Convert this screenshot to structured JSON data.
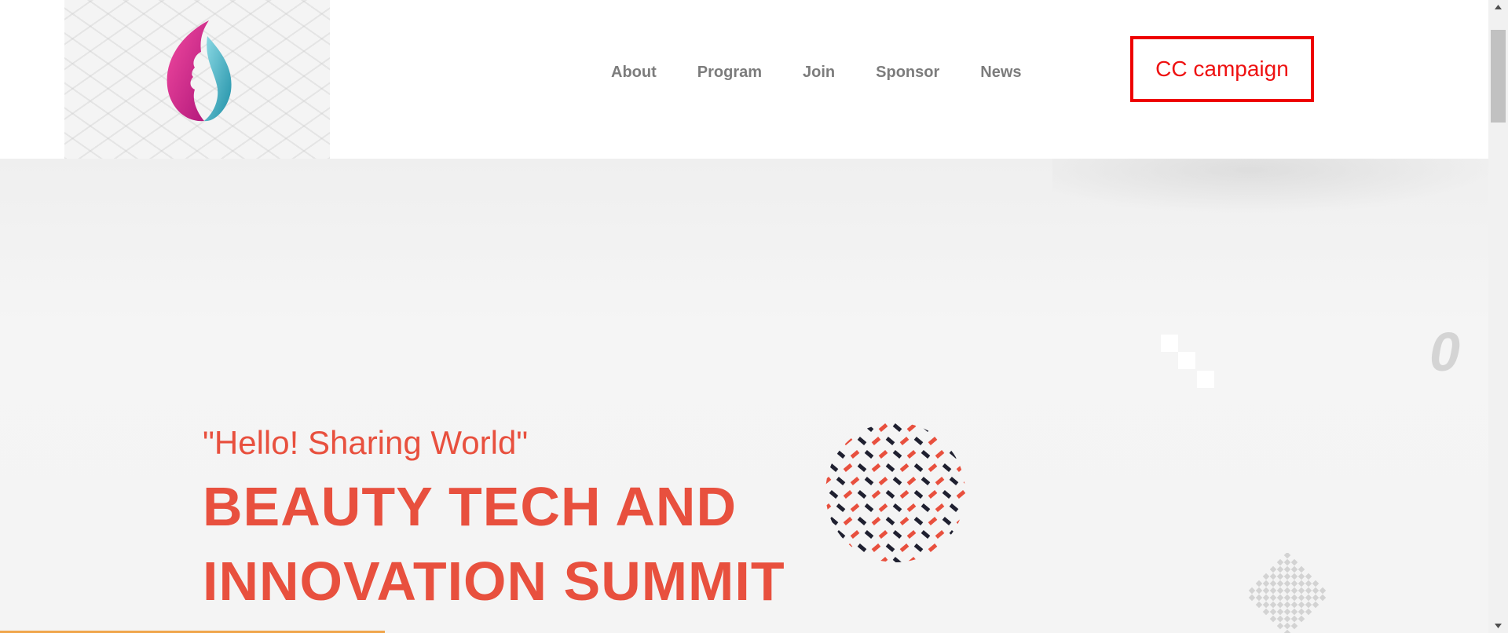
{
  "brand": {
    "logo_icon": "flame-face-logo-icon",
    "colors": {
      "pink": "#e5338a",
      "teal": "#3bb6c9",
      "accent": "#e8503e"
    }
  },
  "nav": {
    "items": [
      {
        "label": "About"
      },
      {
        "label": "Program"
      },
      {
        "label": "Join"
      },
      {
        "label": "Sponsor"
      },
      {
        "label": "News"
      }
    ],
    "cta_label": "CC campaign"
  },
  "hero": {
    "tagline": "\"Hello! Sharing World\"",
    "title_line1": "BEAUTY TECH AND",
    "title_line2": "INNOVATION SUMMIT",
    "decor_glyph": "0"
  }
}
